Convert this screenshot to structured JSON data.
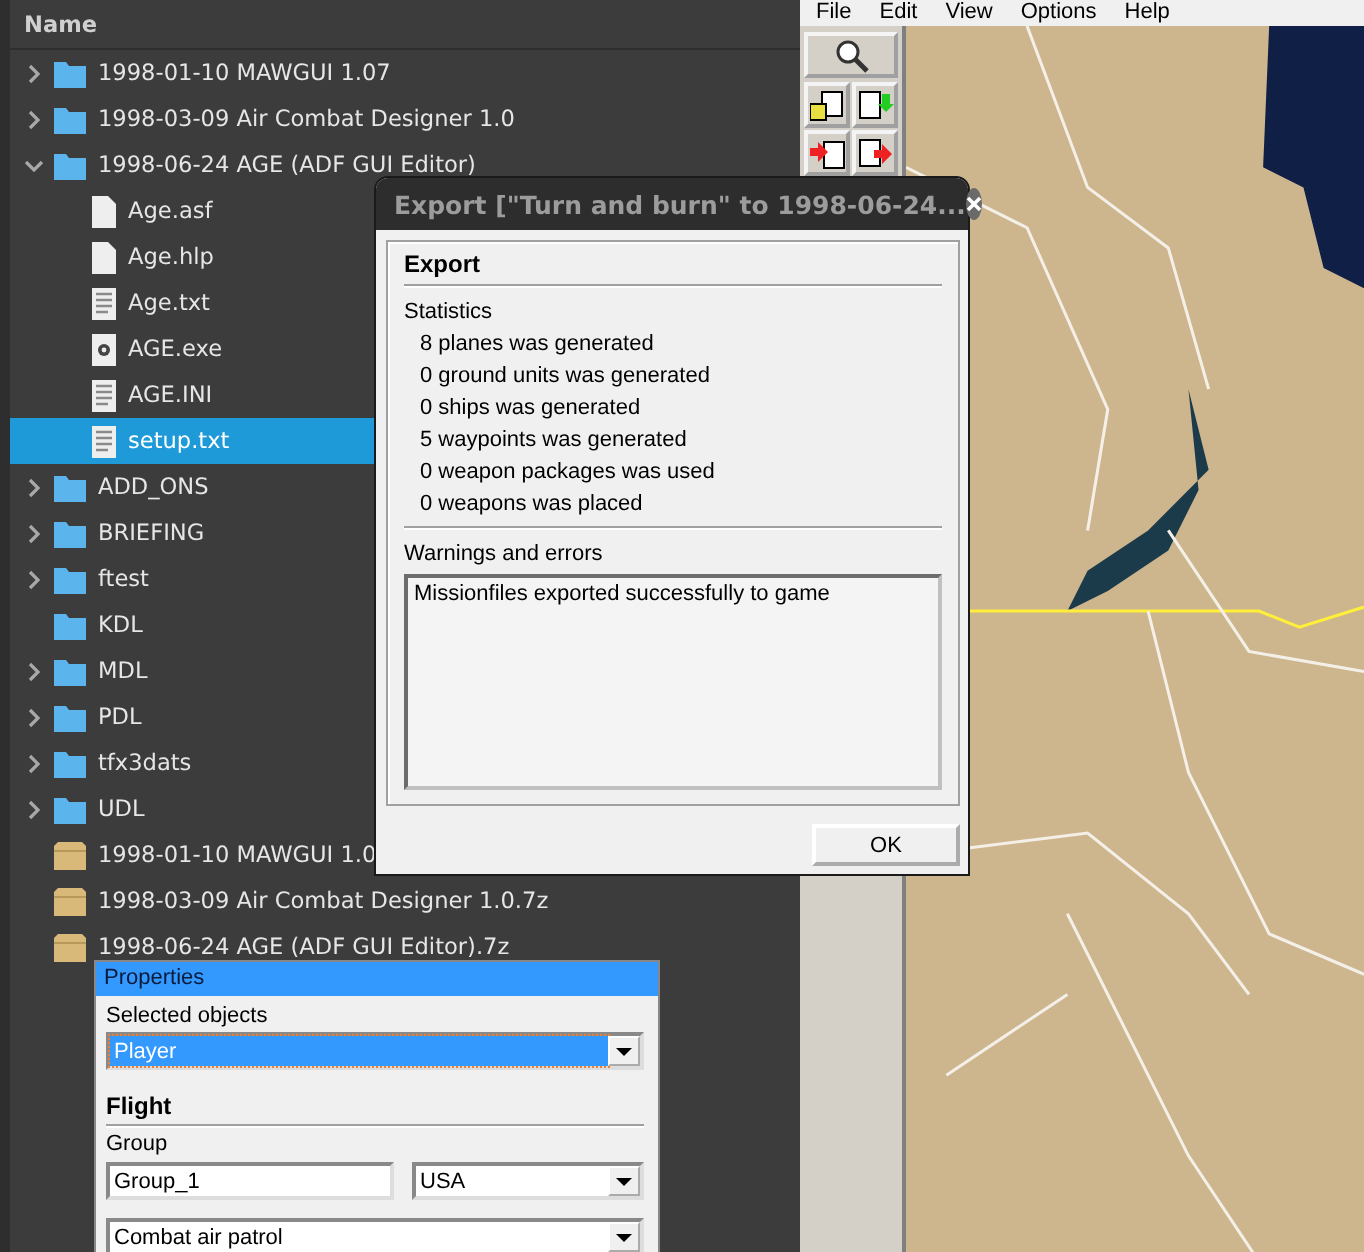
{
  "file_manager": {
    "header": "Name",
    "items": [
      {
        "kind": "folder",
        "name": "1998-01-10 MAWGUI 1.07",
        "expandable": true,
        "expanded": false,
        "selected": false
      },
      {
        "kind": "folder",
        "name": "1998-03-09 Air Combat Designer 1.0",
        "expandable": true,
        "expanded": false,
        "selected": false
      },
      {
        "kind": "folder",
        "name": "1998-06-24 AGE (ADF GUI Editor)",
        "expandable": true,
        "expanded": true,
        "selected": false,
        "children": [
          {
            "kind": "file",
            "name": "Age.asf",
            "selected": false
          },
          {
            "kind": "file",
            "name": "Age.hlp",
            "selected": false
          },
          {
            "kind": "text",
            "name": "Age.txt",
            "selected": false
          },
          {
            "kind": "exe",
            "name": "AGE.exe",
            "selected": false
          },
          {
            "kind": "text",
            "name": "AGE.INI",
            "selected": false
          },
          {
            "kind": "text",
            "name": "setup.txt",
            "selected": true
          }
        ]
      },
      {
        "kind": "folder",
        "name": "ADD_ONS",
        "expandable": true,
        "expanded": false,
        "selected": false
      },
      {
        "kind": "folder",
        "name": "BRIEFING",
        "expandable": true,
        "expanded": false,
        "selected": false
      },
      {
        "kind": "folder",
        "name": "ftest",
        "expandable": true,
        "expanded": false,
        "selected": false
      },
      {
        "kind": "folder",
        "name": "KDL",
        "selected": false
      },
      {
        "kind": "folder",
        "name": "MDL",
        "expandable": true,
        "expanded": false,
        "selected": false
      },
      {
        "kind": "folder",
        "name": "PDL",
        "expandable": true,
        "expanded": false,
        "selected": false
      },
      {
        "kind": "folder",
        "name": "tfx3dats",
        "expandable": true,
        "expanded": false,
        "selected": false
      },
      {
        "kind": "folder",
        "name": "UDL",
        "expandable": true,
        "expanded": false,
        "selected": false
      },
      {
        "kind": "archive",
        "name": "1998-01-10 MAWGUI 1.0",
        "selected": false
      },
      {
        "kind": "archive",
        "name": "1998-03-09 Air Combat Designer 1.0.7z",
        "selected": false
      },
      {
        "kind": "archive",
        "name": "1998-06-24 AGE (ADF GUI Editor).7z",
        "selected": false
      }
    ]
  },
  "editor": {
    "menu": [
      "File",
      "Edit",
      "View",
      "Options",
      "Help"
    ]
  },
  "export_dialog": {
    "title": "Export [\"Turn and burn\" to 1998-06-24...",
    "heading": "Export",
    "statistics_label": "Statistics",
    "statistics": [
      "8 planes was generated",
      "0 ground units was generated",
      "0 ships was generated",
      "5 waypoints was generated",
      "0 weapon packages was used",
      "0 weapons was placed"
    ],
    "warnings_label": "Warnings and errors",
    "log": "Missionfiles exported successfully to game",
    "ok_button": "OK"
  },
  "properties": {
    "title": "Properties",
    "selected_objects_label": "Selected objects",
    "selected_object": "Player",
    "section": "Flight",
    "group_label": "Group",
    "group_value": "Group_1",
    "country": "USA",
    "task": "Combat air patrol"
  }
}
